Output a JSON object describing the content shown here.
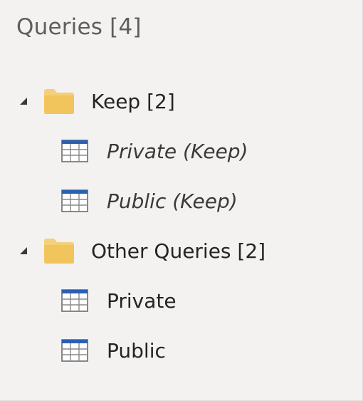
{
  "panel": {
    "title": "Queries [4]"
  },
  "groups": [
    {
      "label": "Keep [2]",
      "expanded": true,
      "queries": [
        {
          "label": "Private (Keep)",
          "italic": true
        },
        {
          "label": "Public (Keep)",
          "italic": true
        }
      ]
    },
    {
      "label": "Other Queries [2]",
      "expanded": true,
      "queries": [
        {
          "label": "Private",
          "italic": false
        },
        {
          "label": "Public",
          "italic": false
        }
      ]
    }
  ],
  "colors": {
    "background": "#f3f2f1",
    "folder": "#f2c94c",
    "table_header": "#2b5fb0",
    "table_grid": "#7a7a7a"
  },
  "icons": {
    "caret": "caret-expanded-icon",
    "folder": "folder-icon",
    "query": "table-icon"
  }
}
